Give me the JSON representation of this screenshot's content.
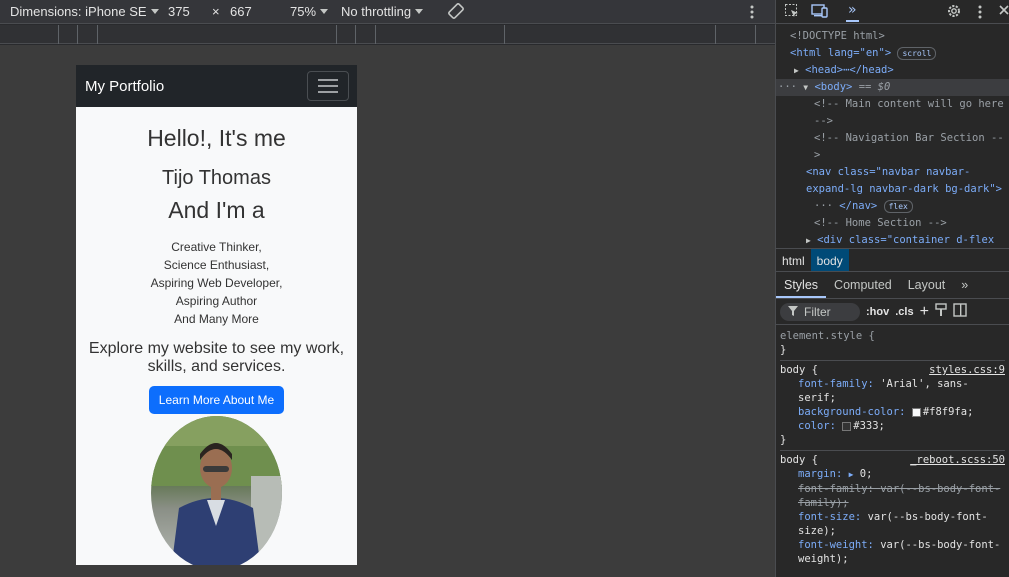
{
  "toolbar": {
    "dimensions_label": "Dimensions: iPhone SE",
    "width": "375",
    "times": "×",
    "height": "667",
    "zoom": "75%",
    "throttling": "No throttling"
  },
  "page": {
    "brand": "My Portfolio",
    "hello": "Hello!, It's me",
    "name": "Tijo Thomas",
    "iam": "And I'm a",
    "roles": [
      "Creative Thinker,",
      "Science Enthusiast,",
      "Aspiring Web Developer,",
      "Aspiring Author",
      "And Many More"
    ],
    "explore": "Explore my website to see my work, skills, and services.",
    "button": "Learn More About Me"
  },
  "devtools": {
    "dom": {
      "doctype": "<!DOCTYPE html>",
      "html_open": "<html lang=\"en\">",
      "html_badge": "scroll",
      "head": "<head>⋯</head>",
      "body": "<body>",
      "body_sel": "== $0",
      "comment1": "<!-- Main content will go here -->",
      "comment2": "<!-- Navigation Bar Section -->",
      "nav": "<nav class=\"navbar navbar-expand-lg navbar-dark bg-dark\">",
      "nav_close": "</nav>",
      "nav_badge": "flex",
      "comment3": "<!-- Home Section -->",
      "div": "<div class=\"container d-flex"
    },
    "breadcrumbs": [
      "html",
      "body"
    ],
    "tabs": [
      "Styles",
      "Computed",
      "Layout"
    ],
    "filter_placeholder": "Filter",
    "hov": ":hov",
    "cls": ".cls",
    "element_style": "element.style {",
    "close_brace": "}",
    "rule1": {
      "selector": "body {",
      "source": "styles.css:9",
      "p1": "font-family",
      "v1": "'Arial', sans-serif;",
      "p2": "background-color",
      "v2": "#f8f9fa;",
      "p3": "color",
      "v3": "#333;"
    },
    "rule2": {
      "selector": "body {",
      "source": "_reboot.scss:50",
      "p1": "margin",
      "v1": "0;",
      "p2": "font-family",
      "v2": "var(--bs-body-font-family);",
      "p3": "font-size",
      "v3": "var(--bs-body-font-size);",
      "p4": "font-weight",
      "v4": "var(--bs-body-font-weight);"
    }
  },
  "colors": {
    "navbar_bg": "#212529",
    "button_bg": "#0d6efd",
    "page_bg": "#f8f9fa",
    "accent": "#a8c7fa"
  }
}
